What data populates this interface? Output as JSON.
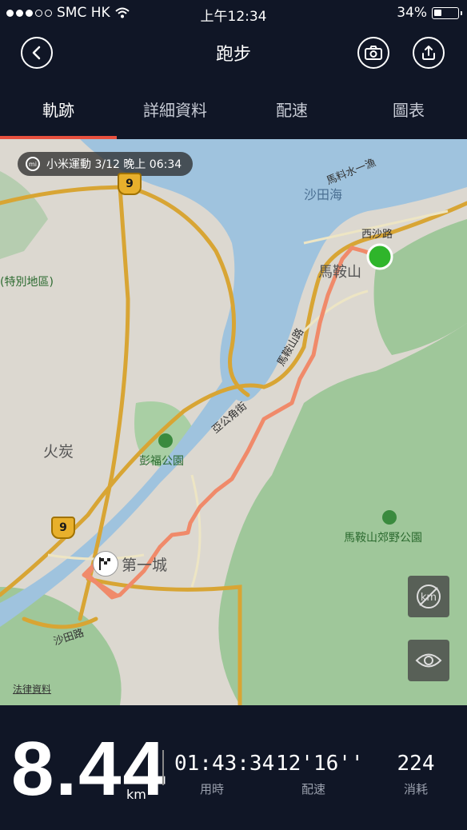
{
  "status_bar": {
    "carrier": "SMC HK",
    "time": "上午12:34",
    "battery": "34%",
    "battery_level": 0.34
  },
  "nav": {
    "title": "跑步",
    "back_icon": "back-chevron-icon",
    "camera_icon": "camera-icon",
    "share_icon": "share-icon"
  },
  "tabs": [
    {
      "label": "軌跡",
      "active": true
    },
    {
      "label": "詳細資料",
      "active": false
    },
    {
      "label": "配速",
      "active": false
    },
    {
      "label": "圖表",
      "active": false
    }
  ],
  "map": {
    "record_info": "小米運動 3/12 晚上 06:34",
    "labels": {
      "sha_tin_hoi": "沙田海",
      "sai_sha_road": "西沙路",
      "ma_on_shan": "馬鞍山",
      "ma_on_shan_road": "馬鞍山路",
      "special_area": "(特別地區)",
      "ah_kung_ngam_street": "亞公角街",
      "fo_tan": "火炭",
      "pang_fuk_park": "彭福公園",
      "ma_on_shan_country_park": "馬鞍山郊野公園",
      "city_one": "第一城",
      "sha_tin_road": "沙田路",
      "ma_liu_shui": "馬料水一漁"
    },
    "route_shields": [
      "9",
      "9"
    ],
    "legal_link": "法律資料",
    "colors": {
      "route": "#f08a6a",
      "start": "#2fb52b",
      "water": "#9fc3de",
      "park": "#9fc79a"
    }
  },
  "stats": {
    "distance": "8.44",
    "distance_unit": "km",
    "items": [
      {
        "value": "01:43:34",
        "label": "用時"
      },
      {
        "value": "12'16''",
        "label": "配速"
      },
      {
        "value": "224",
        "label": "消耗"
      }
    ]
  }
}
